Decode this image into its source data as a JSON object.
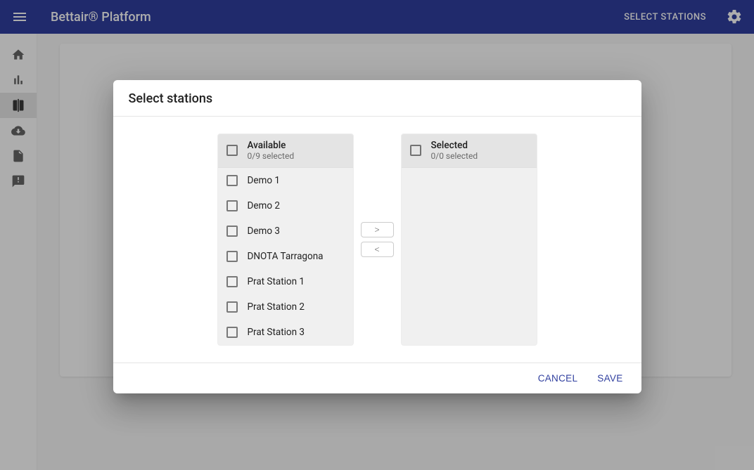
{
  "appbar": {
    "title": "Bettair® Platform",
    "select_stations": "SELECT STATIONS"
  },
  "dialog": {
    "title": "Select stations",
    "available": {
      "label": "Available",
      "sublabel": "0/9 selected",
      "items": [
        "Demo 1",
        "Demo 2",
        "Demo 3",
        "DNOTA Tarragona",
        "Prat Station 1",
        "Prat Station 2",
        "Prat Station 3"
      ]
    },
    "selected": {
      "label": "Selected",
      "sublabel": "0/0 selected",
      "items": []
    },
    "move_right": ">",
    "move_left": "<",
    "cancel": "Cancel",
    "save": "Save"
  }
}
